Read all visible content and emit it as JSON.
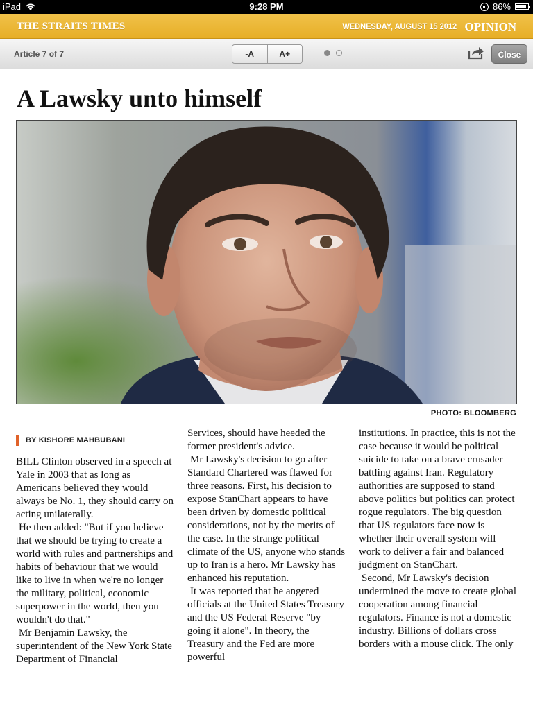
{
  "status_bar": {
    "device": "iPad",
    "time": "9:28 PM",
    "battery_percent": "86%",
    "battery_level": 0.86
  },
  "masthead": {
    "paper_name": "THE STRAITS TIMES",
    "date": "WEDNESDAY, AUGUST 15 2012",
    "section": "OPINION"
  },
  "toolbar": {
    "article_counter": "Article 7 of 7",
    "font_decrease_label": "-A",
    "font_increase_label": "A+",
    "page_count": 2,
    "current_page": 1,
    "close_label": "Close"
  },
  "article": {
    "headline": "A Lawsky unto himself",
    "photo_credit": "PHOTO: BLOOMBERG",
    "byline": "BY KISHORE MAHBUBANI",
    "columns": [
      [
        "BILL Clinton observed in a speech at Yale in 2003 that as long as Americans believed they would always be No. 1, they should carry on acting unilaterally.",
        "He then added: \"But if you believe that we should be trying to create a world with rules and partnerships and habits of behaviour that we would like to live in when we're no longer the military, political, economic superpower in the world, then you wouldn't do that.\"",
        "Mr Benjamin Lawsky, the superintendent of the New York State Department of Financial"
      ],
      [
        "Services, should have heeded the former president's advice.",
        "Mr Lawsky's decision to go after Standard Chartered was flawed for three reasons. First, his decision to expose StanChart appears to have been driven by domestic political considerations, not by the merits of the case. In the strange political climate of the US, anyone who stands up to Iran is a hero. Mr Lawsky has enhanced his reputation.",
        "It was reported that he angered officials at the United States Treasury and the US Federal Reserve \"by going it alone\". In theory, the Treasury and the Fed are more powerful"
      ],
      [
        "institutions. In practice, this is not the case because it would be political suicide to take on a brave crusader battling against Iran. Regulatory authorities are supposed to stand above politics but politics can protect rogue regulators. The big question that US regulators face now is whether their overall system will work to deliver a fair and balanced judgment on StanChart.",
        "Second, Mr Lawsky's decision undermined the move to create global cooperation among financial regulators. Finance is not a domestic industry. Billions of dollars cross borders with a mouse click. The only"
      ]
    ]
  },
  "colors": {
    "masthead_yellow": "#e9b12f",
    "byline_accent": "#e0622a"
  }
}
